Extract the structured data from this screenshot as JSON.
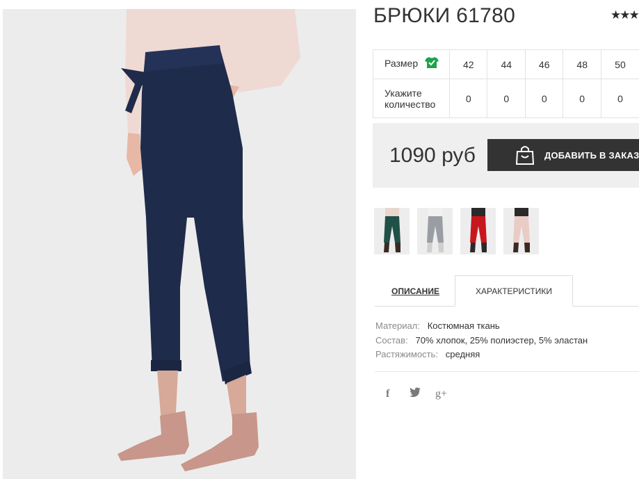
{
  "product": {
    "title": "БРЮКИ 61780",
    "rating_stars": "★★★",
    "rating_stars_visible": 3,
    "photo_subject": "navy-trousers-model",
    "colors": {
      "pants": "#1f2b4a",
      "shoes": "#c8968a",
      "blouse": "#efd9d3",
      "background": "#ececec"
    }
  },
  "size_table": {
    "size_label": "Размер",
    "qty_label_line1": "Укажите",
    "qty_label_line2": "количество",
    "sizes": [
      "42",
      "44",
      "46",
      "48",
      "50"
    ],
    "quantities": [
      "0",
      "0",
      "0",
      "0",
      "0"
    ],
    "size_icon": "shirt-check-icon",
    "icon_color": "#1fa34a"
  },
  "price": {
    "amount": "1090 руб",
    "add_button_label": "ДОБАВИТЬ В ЗАКАЗ",
    "add_button_icon": "shopping-bag-icon"
  },
  "thumbnails": [
    {
      "name": "green",
      "color": "#1f5147"
    },
    {
      "name": "grey",
      "color": "#9a9ea4"
    },
    {
      "name": "red",
      "color": "#c8161d"
    },
    {
      "name": "pink",
      "color": "#e9ccc6"
    }
  ],
  "tabs": {
    "description": "ОПИСАНИЕ",
    "characteristics": "ХАРАКТЕРИСТИКИ",
    "active": "characteristics"
  },
  "characteristics": [
    {
      "key": "Материал:",
      "value": "Костюмная ткань"
    },
    {
      "key": "Состав:",
      "value": "70% хлопок, 25% полиэстер, 5% эластан"
    },
    {
      "key": "Растяжимость:",
      "value": "средняя"
    }
  ],
  "social": {
    "facebook": "f",
    "twitter": "twitter-icon",
    "googleplus": "g+"
  }
}
